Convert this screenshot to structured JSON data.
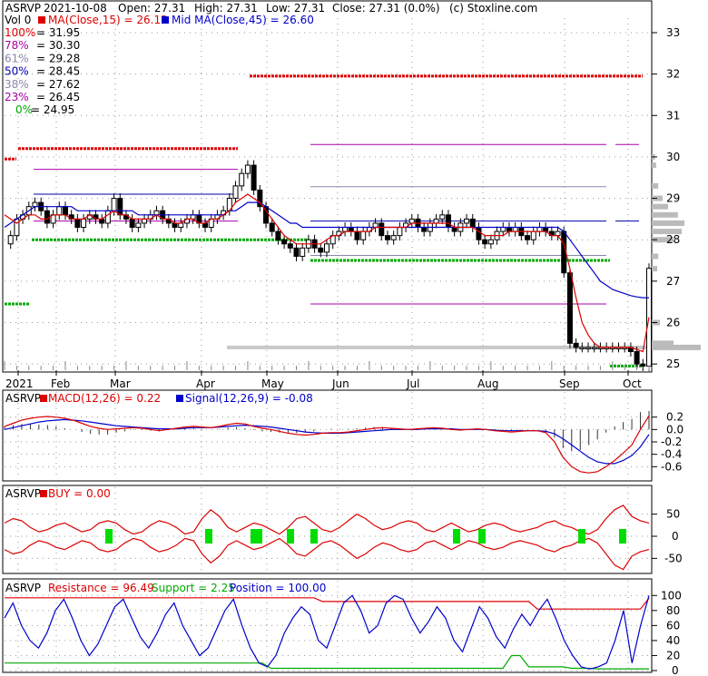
{
  "chart_data": [
    {
      "type": "candlestick",
      "header": {
        "ticker": "ASRVP",
        "date": "2021-10-08",
        "open": "Open: 27.31",
        "high": "High: 27.31",
        "low": "Low: 27.31",
        "close": "Close: 27.31 (0.0%)",
        "source": "(c) Stoxline.com"
      },
      "ma_line": {
        "vol": "Vol 0",
        "ma15": "MA(Close,15) = 26.13",
        "ma45": "Mid MA(Close,45) = 26.60"
      },
      "fib_levels": [
        {
          "label": "100% = 31.95",
          "value": 31.95,
          "color": "#dd0000"
        },
        {
          "label": "78% = 30.30",
          "value": 30.3,
          "color": "#aa00aa"
        },
        {
          "label": "61% = 29.28",
          "value": 29.28,
          "color": "#8888aa"
        },
        {
          "label": "50% = 28.45",
          "value": 28.45,
          "color": "#0000aa"
        },
        {
          "label": "38% = 27.62",
          "value": 27.62,
          "color": "#8888aa"
        },
        {
          "label": "23% = 26.45",
          "value": 26.45,
          "color": "#aa00aa"
        },
        {
          "label": "0% = 24.95",
          "value": 24.95,
          "color": "#00aa00"
        }
      ],
      "y_ticks": [
        25,
        26,
        27,
        28,
        29,
        30,
        31,
        32,
        33
      ],
      "ylim": [
        24.85,
        33.35
      ],
      "x_ticks": [
        "2021",
        "Feb",
        "Mar",
        "Apr",
        "May",
        "Jun",
        "Jul",
        "Aug",
        "Sep",
        "Oct"
      ],
      "close_series": [
        27.9,
        28.1,
        28.5,
        28.6,
        28.8,
        28.9,
        28.7,
        28.4,
        28.6,
        28.8,
        28.6,
        28.5,
        28.3,
        28.5,
        28.6,
        28.5,
        28.4,
        28.7,
        29.0,
        28.6,
        28.5,
        28.3,
        28.4,
        28.5,
        28.6,
        28.7,
        28.5,
        28.4,
        28.3,
        28.4,
        28.5,
        28.6,
        28.4,
        28.3,
        28.5,
        28.6,
        28.7,
        29.0,
        29.3,
        29.6,
        29.8,
        29.2,
        28.8,
        28.4,
        28.2,
        28.0,
        27.9,
        27.8,
        27.6,
        27.8,
        28.0,
        27.8,
        27.7,
        27.9,
        28.1,
        28.2,
        28.3,
        28.2,
        28.0,
        28.2,
        28.3,
        28.4,
        28.1,
        28.0,
        28.1,
        28.3,
        28.4,
        28.5,
        28.3,
        28.2,
        28.4,
        28.5,
        28.6,
        28.3,
        28.2,
        28.4,
        28.5,
        28.3,
        28.0,
        27.9,
        28.0,
        28.2,
        28.3,
        28.2,
        28.3,
        28.1,
        28.0,
        28.2,
        28.3,
        28.2,
        28.1,
        28.2,
        27.2,
        25.5,
        25.4,
        25.4,
        25.4,
        25.4,
        25.4,
        25.4,
        25.4,
        25.4,
        25.4,
        25.3,
        25.0,
        24.95,
        27.31
      ],
      "ma15_series": [
        28.6,
        28.5,
        28.4,
        28.5,
        28.6,
        28.6,
        28.5,
        28.5,
        28.6,
        28.6,
        28.6,
        28.5,
        28.5,
        28.5,
        28.6,
        28.5,
        28.5,
        28.6,
        28.7,
        28.6,
        28.6,
        28.5,
        28.5,
        28.5,
        28.5,
        28.6,
        28.5,
        28.5,
        28.4,
        28.4,
        28.5,
        28.5,
        28.4,
        28.4,
        28.5,
        28.5,
        28.6,
        28.7,
        28.9,
        29.0,
        29.1,
        29.0,
        28.9,
        28.7,
        28.5,
        28.3,
        28.1,
        28.0,
        27.9,
        27.9,
        27.9,
        27.9,
        27.9,
        28.0,
        28.1,
        28.1,
        28.2,
        28.2,
        28.2,
        28.2,
        28.2,
        28.3,
        28.3,
        28.3,
        28.3,
        28.3,
        28.3,
        28.4,
        28.4,
        28.4,
        28.4,
        28.4,
        28.4,
        28.4,
        28.3,
        28.3,
        28.3,
        28.3,
        28.2,
        28.1,
        28.1,
        28.1,
        28.1,
        28.2,
        28.2,
        28.2,
        28.2,
        28.2,
        28.2,
        28.2,
        28.1,
        28.1,
        27.9,
        27.3,
        26.6,
        26.0,
        25.7,
        25.5,
        25.4,
        25.4,
        25.4,
        25.4,
        25.4,
        25.4,
        25.35,
        25.3,
        26.13
      ],
      "ma45_series": [
        28.3,
        28.4,
        28.5,
        28.6,
        28.7,
        28.8,
        28.8,
        28.8,
        28.8,
        28.8,
        28.8,
        28.8,
        28.7,
        28.7,
        28.7,
        28.7,
        28.7,
        28.7,
        28.7,
        28.7,
        28.7,
        28.7,
        28.6,
        28.6,
        28.6,
        28.6,
        28.6,
        28.6,
        28.6,
        28.6,
        28.6,
        28.6,
        28.6,
        28.6,
        28.6,
        28.6,
        28.6,
        28.7,
        28.7,
        28.8,
        28.9,
        28.9,
        28.9,
        28.8,
        28.7,
        28.6,
        28.5,
        28.4,
        28.4,
        28.3,
        28.3,
        28.3,
        28.3,
        28.3,
        28.3,
        28.3,
        28.3,
        28.3,
        28.3,
        28.3,
        28.3,
        28.3,
        28.3,
        28.3,
        28.3,
        28.3,
        28.3,
        28.3,
        28.3,
        28.3,
        28.3,
        28.3,
        28.3,
        28.3,
        28.3,
        28.3,
        28.3,
        28.3,
        28.3,
        28.3,
        28.3,
        28.3,
        28.3,
        28.3,
        28.3,
        28.3,
        28.3,
        28.3,
        28.3,
        28.3,
        28.3,
        28.3,
        28.2,
        28.0,
        27.8,
        27.6,
        27.4,
        27.2,
        27.0,
        26.9,
        26.8,
        26.75,
        26.7,
        26.65,
        26.62,
        26.6,
        26.6
      ],
      "support_level": 28.0,
      "resistance_level": 30.2,
      "upper_level": 31.95,
      "lower_level": 27.5
    },
    {
      "type": "macd",
      "ticker": "ASRVP",
      "title": "MACD(12,26) = 0.22",
      "signal": "Signal(12,26,9) = -0.08",
      "y_ticks": [
        0.2,
        0.0,
        -0.2,
        -0.4,
        -0.6
      ],
      "ylim": [
        -0.8,
        0.4
      ],
      "macd": [
        0.05,
        0.1,
        0.15,
        0.18,
        0.2,
        0.21,
        0.2,
        0.18,
        0.15,
        0.1,
        0.05,
        0.02,
        0.0,
        0.01,
        0.02,
        0.03,
        0.02,
        0.0,
        -0.02,
        0.0,
        0.02,
        0.04,
        0.05,
        0.04,
        0.03,
        0.05,
        0.08,
        0.1,
        0.09,
        0.05,
        0.02,
        0.0,
        -0.03,
        -0.06,
        -0.08,
        -0.09,
        -0.08,
        -0.06,
        -0.05,
        -0.05,
        -0.04,
        -0.02,
        0.0,
        0.02,
        0.03,
        0.02,
        0.01,
        0.0,
        0.01,
        0.02,
        0.03,
        0.02,
        0.0,
        -0.01,
        0.0,
        0.01,
        0.0,
        -0.02,
        -0.03,
        -0.04,
        -0.03,
        -0.02,
        -0.02,
        -0.05,
        -0.2,
        -0.45,
        -0.6,
        -0.68,
        -0.7,
        -0.68,
        -0.6,
        -0.5,
        -0.38,
        -0.25,
        0.0,
        0.22
      ],
      "signal_series": [
        0.0,
        0.03,
        0.06,
        0.09,
        0.12,
        0.14,
        0.15,
        0.16,
        0.15,
        0.14,
        0.12,
        0.1,
        0.08,
        0.06,
        0.05,
        0.04,
        0.03,
        0.02,
        0.01,
        0.01,
        0.01,
        0.02,
        0.03,
        0.03,
        0.03,
        0.04,
        0.05,
        0.06,
        0.07,
        0.06,
        0.05,
        0.04,
        0.02,
        0.0,
        -0.02,
        -0.04,
        -0.05,
        -0.06,
        -0.06,
        -0.06,
        -0.05,
        -0.04,
        -0.03,
        -0.02,
        -0.01,
        0.0,
        0.0,
        0.0,
        0.0,
        0.01,
        0.01,
        0.01,
        0.01,
        0.0,
        0.0,
        0.0,
        0.0,
        -0.01,
        -0.02,
        -0.02,
        -0.02,
        -0.02,
        -0.02,
        -0.03,
        -0.07,
        -0.15,
        -0.25,
        -0.35,
        -0.45,
        -0.52,
        -0.55,
        -0.55,
        -0.5,
        -0.42,
        -0.28,
        -0.08
      ]
    },
    {
      "type": "line",
      "ticker": "ASRVP",
      "title": "BUY = 0.00",
      "y_ticks": [
        50,
        0,
        -50
      ],
      "ylim": [
        -80,
        80
      ],
      "upper": [
        30,
        40,
        35,
        20,
        10,
        15,
        25,
        30,
        20,
        10,
        15,
        30,
        35,
        30,
        15,
        5,
        10,
        25,
        35,
        30,
        20,
        5,
        10,
        40,
        60,
        45,
        20,
        10,
        20,
        30,
        25,
        15,
        5,
        20,
        40,
        45,
        30,
        15,
        10,
        20,
        35,
        50,
        40,
        25,
        15,
        20,
        30,
        35,
        30,
        15,
        10,
        20,
        30,
        20,
        10,
        15,
        25,
        30,
        25,
        15,
        10,
        15,
        20,
        30,
        35,
        25,
        20,
        10,
        5,
        15,
        40,
        60,
        70,
        45,
        35,
        30
      ],
      "lower": [
        -30,
        -40,
        -35,
        -20,
        -10,
        -15,
        -25,
        -30,
        -20,
        -10,
        -15,
        -30,
        -35,
        -30,
        -15,
        -5,
        -10,
        -25,
        -35,
        -30,
        -20,
        -5,
        -10,
        -40,
        -60,
        -45,
        -20,
        -10,
        -20,
        -30,
        -25,
        -15,
        -5,
        -20,
        -40,
        -45,
        -30,
        -15,
        -10,
        -20,
        -35,
        -50,
        -40,
        -25,
        -15,
        -20,
        -30,
        -35,
        -30,
        -15,
        -10,
        -20,
        -30,
        -20,
        -10,
        -15,
        -25,
        -30,
        -25,
        -15,
        -10,
        -15,
        -20,
        -30,
        -35,
        -25,
        -20,
        -10,
        -5,
        -15,
        -40,
        -65,
        -75,
        -45,
        -35,
        -30
      ],
      "buy_marks": [
        "Feb",
        "Mar",
        "Apr",
        "Apr",
        "May",
        "May",
        "Jul",
        "Aug",
        "Sep",
        "Oct"
      ]
    },
    {
      "type": "line",
      "ticker": "ASRVP",
      "resistance": "Resistance = 96.49",
      "support": "Support = 2.25",
      "position": "Position = 100.00",
      "y_ticks": [
        100,
        80,
        60,
        40,
        20,
        0
      ],
      "ylim": [
        0,
        110
      ],
      "position_series": [
        70,
        90,
        60,
        40,
        30,
        50,
        80,
        95,
        70,
        40,
        20,
        35,
        60,
        85,
        95,
        70,
        45,
        30,
        50,
        75,
        90,
        60,
        40,
        20,
        30,
        55,
        80,
        95,
        60,
        30,
        10,
        5,
        20,
        50,
        70,
        85,
        75,
        40,
        30,
        60,
        90,
        100,
        80,
        50,
        60,
        90,
        100,
        95,
        70,
        50,
        65,
        85,
        70,
        40,
        25,
        55,
        85,
        70,
        45,
        30,
        55,
        75,
        60,
        80,
        95,
        70,
        40,
        20,
        5,
        2,
        5,
        10,
        40,
        80,
        10,
        60,
        100
      ],
      "resistance_series": [
        97,
        97,
        97,
        97,
        97,
        97,
        97,
        97,
        97,
        97,
        97,
        97,
        97,
        97,
        97,
        97,
        97,
        97,
        97,
        97,
        97,
        97,
        97,
        97,
        97,
        97,
        97,
        97,
        97,
        97,
        97,
        97,
        97,
        97,
        97,
        97,
        97,
        92,
        92,
        92,
        92,
        92,
        92,
        92,
        92,
        92,
        92,
        92,
        92,
        92,
        92,
        92,
        92,
        92,
        92,
        92,
        92,
        92,
        92,
        92,
        92,
        92,
        82,
        82,
        82,
        82,
        82,
        82,
        82,
        82,
        82,
        82,
        82,
        82,
        82,
        96.49
      ],
      "support_series": [
        10,
        10,
        10,
        10,
        10,
        10,
        10,
        10,
        10,
        10,
        10,
        10,
        10,
        10,
        10,
        10,
        10,
        10,
        10,
        10,
        10,
        10,
        10,
        10,
        10,
        10,
        10,
        10,
        10,
        10,
        10,
        3,
        3,
        3,
        3,
        3,
        3,
        3,
        3,
        3,
        3,
        3,
        3,
        3,
        3,
        3,
        3,
        3,
        3,
        3,
        3,
        3,
        3,
        3,
        3,
        3,
        3,
        3,
        3,
        20,
        20,
        5,
        5,
        5,
        5,
        5,
        3,
        3,
        3,
        2.25,
        2.25,
        2.25,
        2.25,
        2.25,
        2.25,
        2.25
      ]
    }
  ]
}
